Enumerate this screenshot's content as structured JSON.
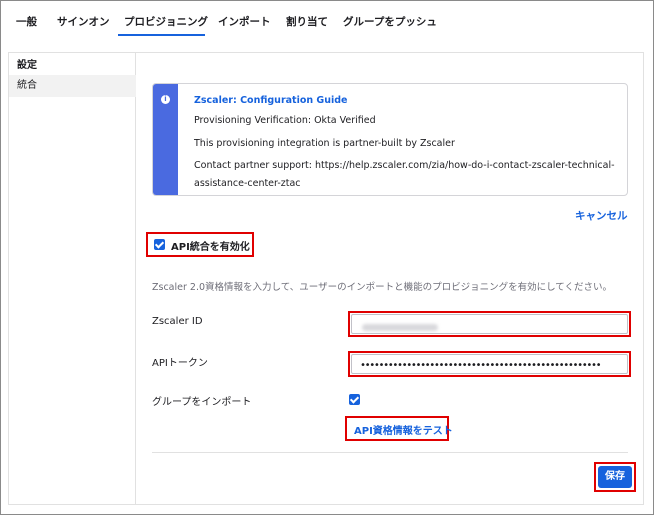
{
  "tabs": [
    {
      "label": "一般"
    },
    {
      "label": "サインオン"
    },
    {
      "label": "プロビジョニング"
    },
    {
      "label": "インポート"
    },
    {
      "label": "割り当て"
    },
    {
      "label": "グループをプッシュ"
    }
  ],
  "active_tab": "プロビジョニング",
  "sidebar": {
    "heading": "設定",
    "items": [
      {
        "label": "統合"
      }
    ]
  },
  "callout": {
    "title": "Zscaler: Configuration Guide",
    "line1": "Provisioning Verification: Okta Verified",
    "line2": "This provisioning integration is partner-built by Zscaler",
    "line3": "Contact partner support: https://help.zscaler.com/zia/how-do-i-contact-zscaler-technical-",
    "line4": "assistance-center-ztac"
  },
  "cancel_label": "キャンセル",
  "enable_api": {
    "label": "API統合を有効化",
    "checked": true
  },
  "description": "Zscaler 2.0資格情報を入力して、ユーザーのインポートと機能のプロビジョニングを有効にしてください。",
  "fields": {
    "zscaler_id": {
      "label": "Zscaler ID"
    },
    "api_token": {
      "label": "APIトークン",
      "value": "••••••••••••••••••••••••••••••••••••••••••••••••••••"
    },
    "import_groups": {
      "label": "グループをインポート",
      "checked": true
    }
  },
  "test_label": "API資格情報をテスト",
  "save_label": "保存",
  "colors": {
    "accent": "#1662dd",
    "callout_bar": "#4a6ae0",
    "highlight": "#e00000"
  }
}
